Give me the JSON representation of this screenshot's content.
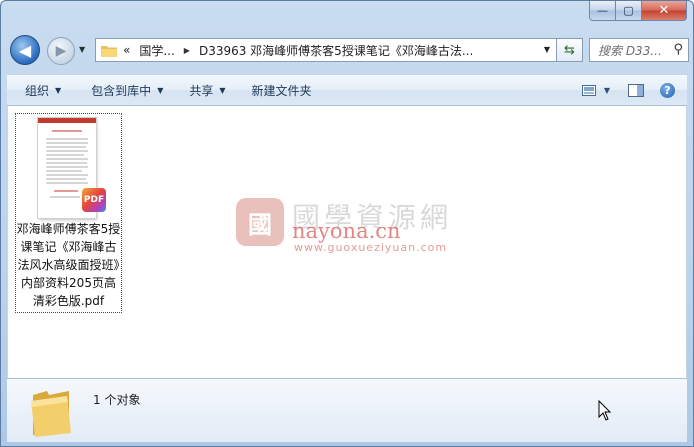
{
  "window": {
    "caption_buttons": {
      "minimize": "—",
      "maximize": "▢",
      "close": "✕"
    }
  },
  "nav": {
    "back_glyph": "◀",
    "forward_glyph": "▶",
    "address": {
      "prefix": "«",
      "crumb1": "国学...",
      "crumb2": "D33963 邓海峰师傅茶客5授课笔记《邓海峰古法..."
    },
    "search_placeholder": "搜索 D33..."
  },
  "toolbar": {
    "organize": "组织",
    "include_library": "包含到库中",
    "share": "共享",
    "new_folder": "新建文件夹"
  },
  "file": {
    "name": "邓海峰师傅茶客5授课笔记《邓海峰古法风水高级面授班》内部资料205页高清彩色版.pdf",
    "badge": "PDF"
  },
  "watermark": {
    "seal": "國",
    "cn": "國學資源網",
    "big": "nayona.cn",
    "url": "www.guoxueziyuan.com"
  },
  "details": {
    "count": "1 个对象"
  },
  "colors": {
    "accent": "#1e395b",
    "window_frame": "#bcd3ec",
    "watermark_red": "#d9534f"
  }
}
